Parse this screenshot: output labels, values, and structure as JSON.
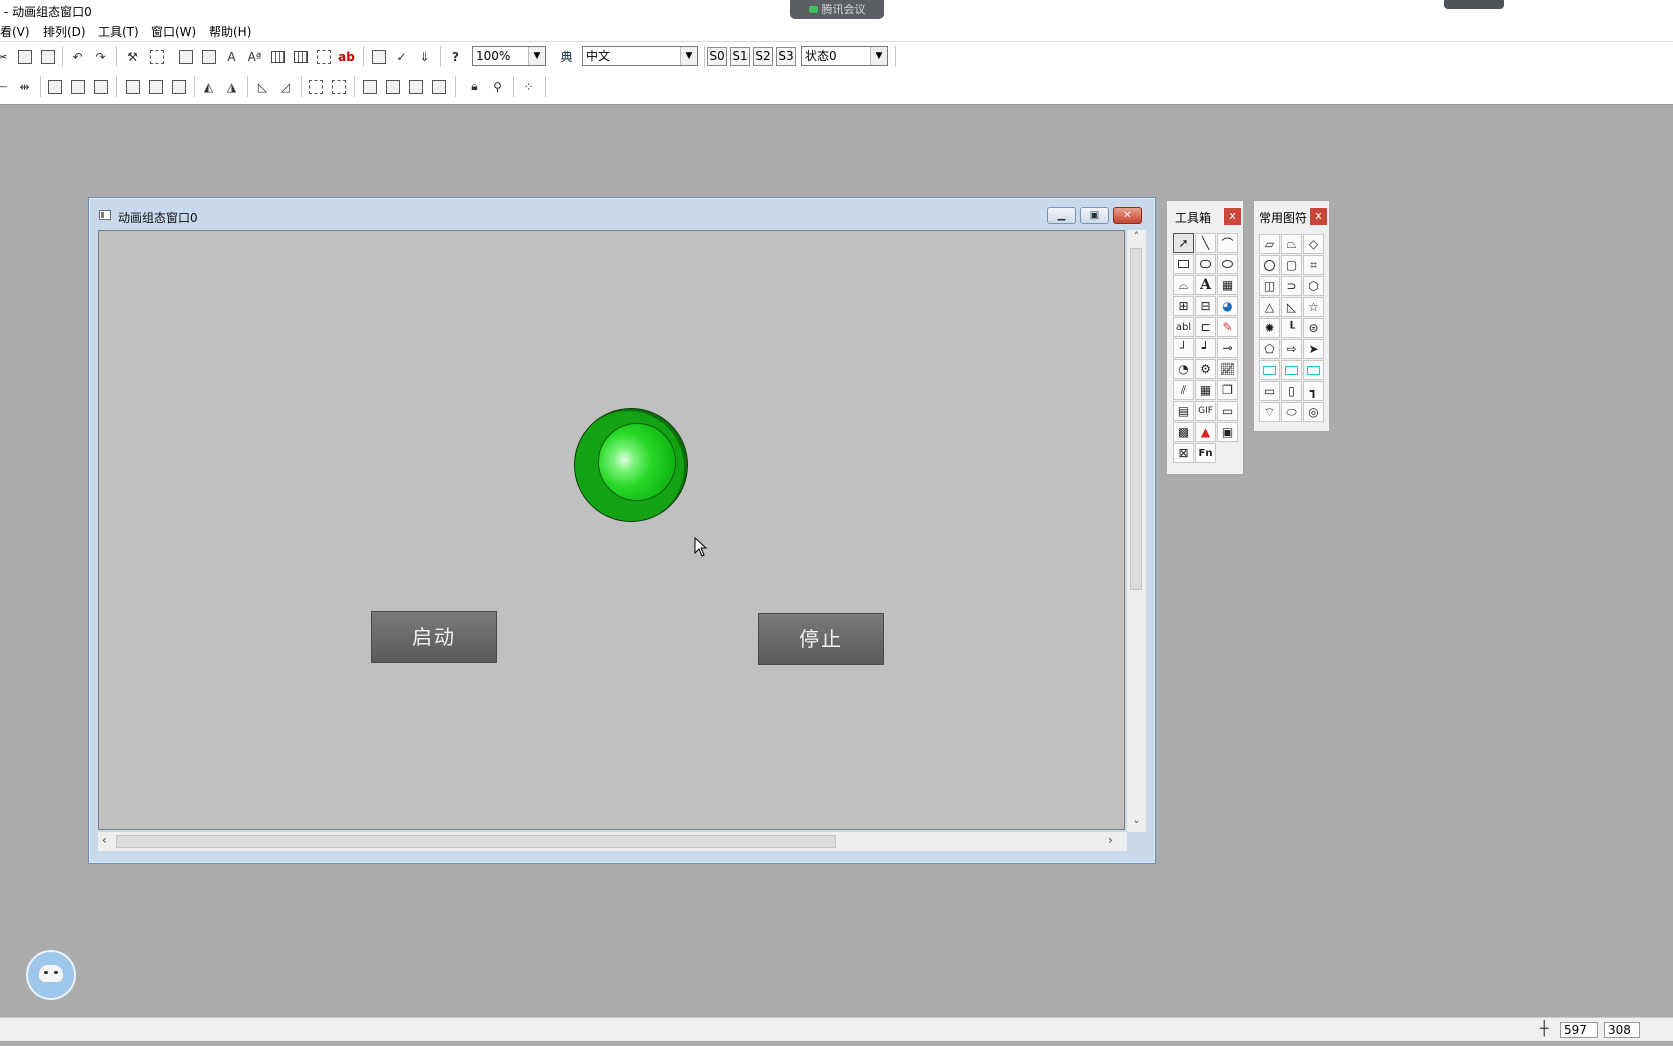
{
  "app": {
    "title": "- 动画组态窗口0",
    "meeting_label": "腾讯会议"
  },
  "menu": {
    "view": "看(V)",
    "arrange": "排列(D)",
    "tools": "工具(T)",
    "window": "窗口(W)",
    "help": "帮助(H)"
  },
  "toolbar": {
    "zoom": "100%",
    "language": "中文",
    "states": [
      "S0",
      "S1",
      "S2",
      "S3"
    ],
    "state_select": "状态0"
  },
  "child_window": {
    "title": "动画组态窗口0",
    "lamp_color": "#13a213",
    "start_button": "启动",
    "stop_button": "停止"
  },
  "toolbox": {
    "title": "工具箱",
    "close": "x",
    "text_tool": "A",
    "label_tool": "abl",
    "gif_tool": "GIF",
    "function_tool": "Fn"
  },
  "shapes_palette": {
    "title": "常用图符",
    "close": "x"
  },
  "statusbar": {
    "coord_x": "597",
    "coord_y": "308"
  },
  "colors": {
    "desktop": "#ababab",
    "canvas": "#c0c0c0",
    "button": "#6a6a6a",
    "close_red": "#c9473a"
  }
}
